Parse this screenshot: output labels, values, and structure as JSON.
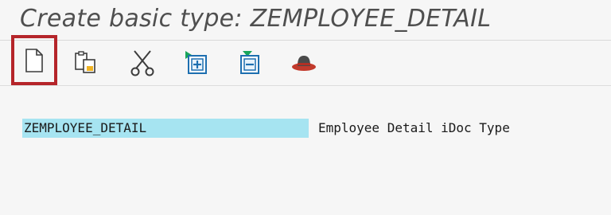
{
  "header": {
    "title": "Create basic type: ZEMPLOYEE_DETAIL"
  },
  "toolbar": {
    "buttons": [
      {
        "icon": "new-document-icon",
        "highlighted": true
      },
      {
        "icon": "copy-icon"
      },
      {
        "icon": "cut-icon"
      },
      {
        "icon": "insert-child-icon"
      },
      {
        "icon": "insert-same-level-icon"
      },
      {
        "icon": "hat-icon"
      }
    ],
    "highlight_color": "#b5252a"
  },
  "main": {
    "basic_type_value": "ZEMPLOYEE_DETAIL",
    "basic_type_description": "Employee Detail iDoc Type",
    "field_highlight_color": "#a6e4f1"
  }
}
